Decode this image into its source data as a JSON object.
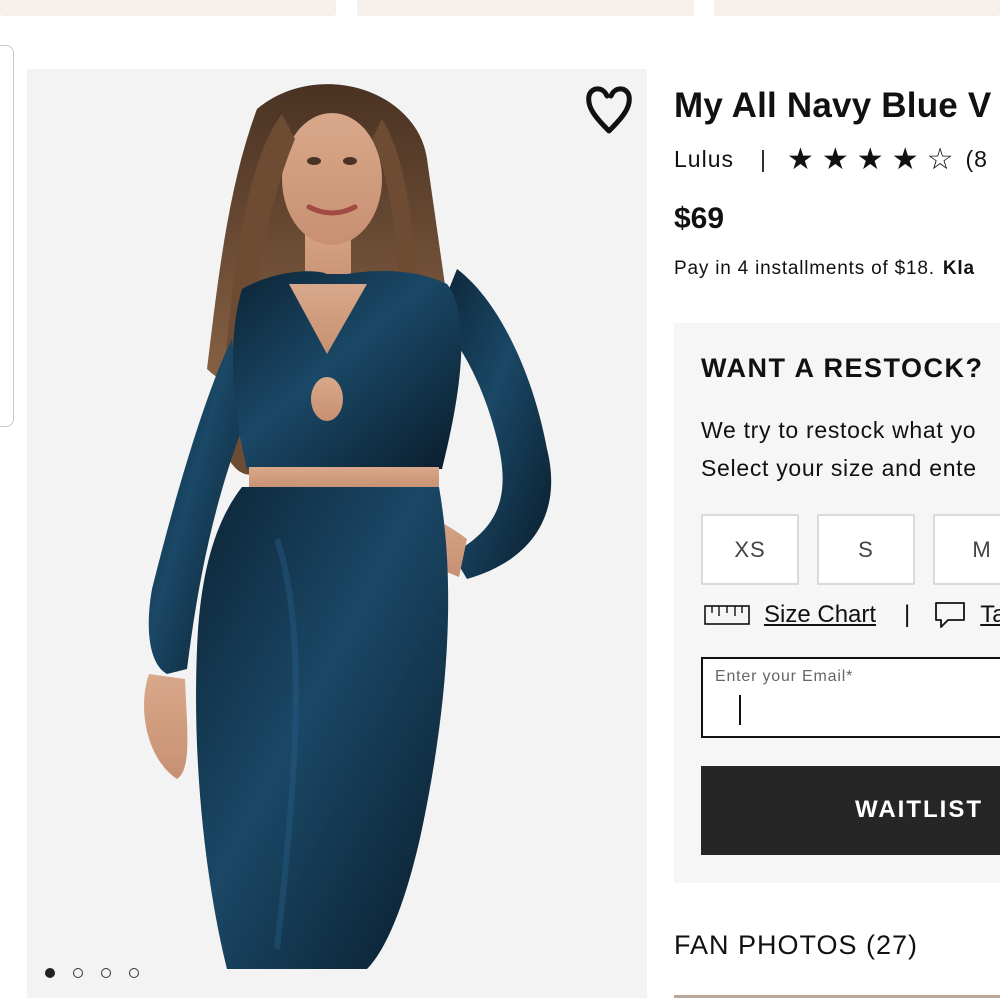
{
  "product": {
    "title": "My All Navy Blue V",
    "brand": "Lulus",
    "separator": "|",
    "rating": {
      "value": 4,
      "max": 5,
      "count_text": "(8"
    },
    "price": "$69",
    "installments_text": "Pay in 4 installments of $18.",
    "klarna_text": "Kla"
  },
  "gallery": {
    "dots": [
      {
        "active": true
      },
      {
        "active": false
      },
      {
        "active": false
      },
      {
        "active": false
      }
    ]
  },
  "restock": {
    "heading": "WANT A RESTOCK?",
    "desc_line1": "We try to restock what yo",
    "desc_line2": "Select your size and ente",
    "sizes": [
      "XS",
      "S",
      "M"
    ],
    "size_chart_label": "Size Chart",
    "separator": "|",
    "second_link_label": "Ta",
    "email_label": "Enter your Email*",
    "email_value": "",
    "waitlist_label": "WAITLIST"
  },
  "fan_photos_label": "FAN PHOTOS (27)",
  "colors": {
    "dress": "#12324a",
    "button_bg": "#262626",
    "panel_bg": "#f6f6f6"
  },
  "icons": {
    "wishlist": "heart-icon",
    "size_chart": "ruler-icon",
    "second_link": "speech-bubble-icon",
    "star_full": "★",
    "star_empty": "☆"
  }
}
